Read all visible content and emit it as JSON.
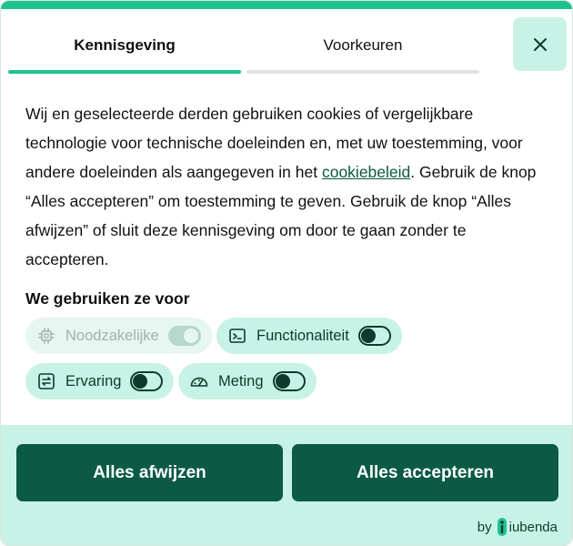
{
  "tabs": [
    {
      "label": "Kennisgeving",
      "active": true
    },
    {
      "label": "Voorkeuren",
      "active": false
    }
  ],
  "close": {
    "icon": "close-icon"
  },
  "notice": {
    "text_before_link": "Wij en geselecteerde derden gebruiken cookies of vergelijkbare technologie voor technische doeleinden en, met uw toestemming, voor andere doeleinden als aangegeven in het ",
    "link_label": "cookiebeleid",
    "text_after_link": ". Gebruik de knop “Alles accepteren” om toestemming te geven. Gebruik de knop “Alles afwijzen” of sluit deze kennisgeving om door te gaan zonder te accepteren."
  },
  "purposes": {
    "title": "We gebruiken ze voor",
    "items": [
      {
        "label": "Noodzakelijke",
        "icon": "chip-icon",
        "enabled": true,
        "locked": true
      },
      {
        "label": "Functionaliteit",
        "icon": "terminal-icon",
        "enabled": false,
        "locked": false
      },
      {
        "label": "Ervaring",
        "icon": "swap-arrows-icon",
        "enabled": false,
        "locked": false
      },
      {
        "label": "Meting",
        "icon": "gauge-icon",
        "enabled": false,
        "locked": false
      }
    ]
  },
  "actions": {
    "reject_label": "Alles afwijzen",
    "accept_label": "Alles accepteren"
  },
  "branding": {
    "by": "by",
    "name": "iubenda"
  },
  "colors": {
    "accent": "#1fc28f",
    "button": "#0b5a44",
    "footer_bg": "#c9f2e6",
    "link": "#0a5a3e"
  }
}
